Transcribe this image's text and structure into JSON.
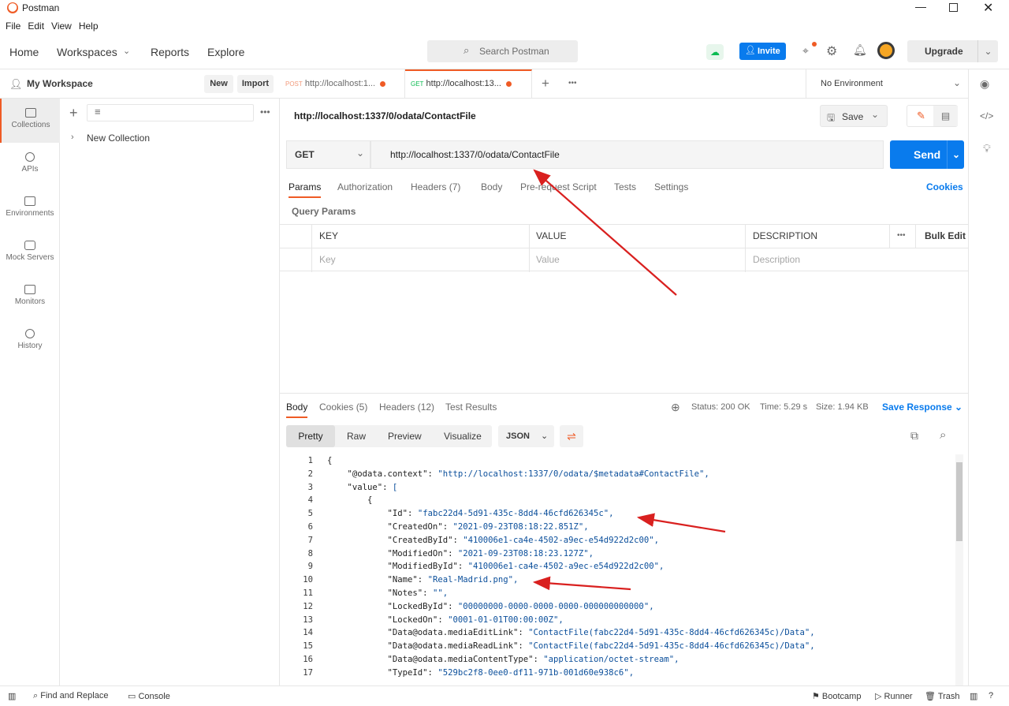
{
  "app": {
    "title": "Postman",
    "menu": [
      "File",
      "Edit",
      "View",
      "Help"
    ]
  },
  "header": {
    "nav": [
      "Home",
      "Workspaces",
      "Reports",
      "Explore"
    ],
    "search_placeholder": "Search Postman",
    "invite_label": "Invite",
    "upgrade_label": "Upgrade"
  },
  "workspace": {
    "name": "My Workspace",
    "new_label": "New",
    "import_label": "Import"
  },
  "sidebar": {
    "items": [
      "Collections",
      "APIs",
      "Environments",
      "Mock Servers",
      "Monitors",
      "History"
    ]
  },
  "collections": {
    "items": [
      "New Collection"
    ]
  },
  "tabs": [
    {
      "method": "POST",
      "url": "http://localhost:1..."
    },
    {
      "method": "GET",
      "url": "http://localhost:13..."
    }
  ],
  "environment": {
    "selected": "No Environment"
  },
  "request": {
    "title": "http://localhost:1337/0/odata/ContactFile",
    "method": "GET",
    "url": "http://localhost:1337/0/odata/ContactFile",
    "save_label": "Save",
    "send_label": "Send",
    "cookies_label": "Cookies",
    "tabs": [
      "Params",
      "Authorization",
      "Headers (7)",
      "Body",
      "Pre-request Script",
      "Tests",
      "Settings"
    ],
    "query_params_label": "Query Params",
    "columns": [
      "KEY",
      "VALUE",
      "DESCRIPTION"
    ],
    "bulk_edit_label": "Bulk Edit",
    "placeholders": {
      "key": "Key",
      "value": "Value",
      "description": "Description"
    }
  },
  "response": {
    "tabs": [
      "Body",
      "Cookies (5)",
      "Headers (12)",
      "Test Results"
    ],
    "status": "Status: 200 OK",
    "time": "Time: 5.29 s",
    "size": "Size: 1.94 KB",
    "save_response_label": "Save Response",
    "views": [
      "Pretty",
      "Raw",
      "Preview",
      "Visualize"
    ],
    "format": "JSON",
    "lines": [
      "{",
      "    \"@odata.context\": \"http://localhost:1337/0/odata/$metadata#ContactFile\",",
      "    \"value\": [",
      "        {",
      "            \"Id\": \"fabc22d4-5d91-435c-8dd4-46cfd626345c\",",
      "            \"CreatedOn\": \"2021-09-23T08:18:22.851Z\",",
      "            \"CreatedById\": \"410006e1-ca4e-4502-a9ec-e54d922d2c00\",",
      "            \"ModifiedOn\": \"2021-09-23T08:18:23.127Z\",",
      "            \"ModifiedById\": \"410006e1-ca4e-4502-a9ec-e54d922d2c00\",",
      "            \"Name\": \"Real-Madrid.png\",",
      "            \"Notes\": \"\",",
      "            \"LockedById\": \"00000000-0000-0000-0000-000000000000\",",
      "            \"LockedOn\": \"0001-01-01T00:00:00Z\",",
      "            \"Data@odata.mediaEditLink\": \"ContactFile(fabc22d4-5d91-435c-8dd4-46cfd626345c)/Data\",",
      "            \"Data@odata.mediaReadLink\": \"ContactFile(fabc22d4-5d91-435c-8dd4-46cfd626345c)/Data\",",
      "            \"Data@odata.mediaContentType\": \"application/octet-stream\",",
      "            \"TypeId\": \"529bc2f8-0ee0-df11-971b-001d60e938c6\","
    ]
  },
  "statusbar": {
    "left": [
      "Find and Replace",
      "Console"
    ],
    "right": [
      "Bootcamp",
      "Runner",
      "Trash"
    ]
  }
}
